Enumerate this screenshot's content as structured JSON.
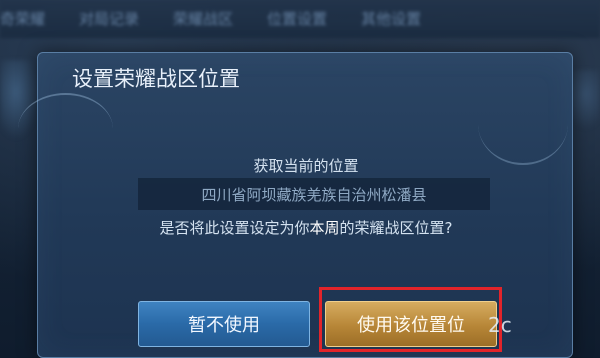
{
  "background": {
    "tabs": [
      "奇荣耀",
      "对局记录",
      "荣耀战区",
      "位置设置",
      "其他设置"
    ]
  },
  "dialog": {
    "title": "设置荣耀战区位置",
    "subtitle": "获取当前的位置",
    "location": "四川省阿坝藏族羌族自治州松潘县",
    "question_before": "是否将此设置设定为你",
    "question_highlight": "本周",
    "question_after": "的荣耀战区位置?",
    "cancel_label": "暂不使用",
    "confirm_label": "使用该位置位"
  },
  "watermark": "2c"
}
